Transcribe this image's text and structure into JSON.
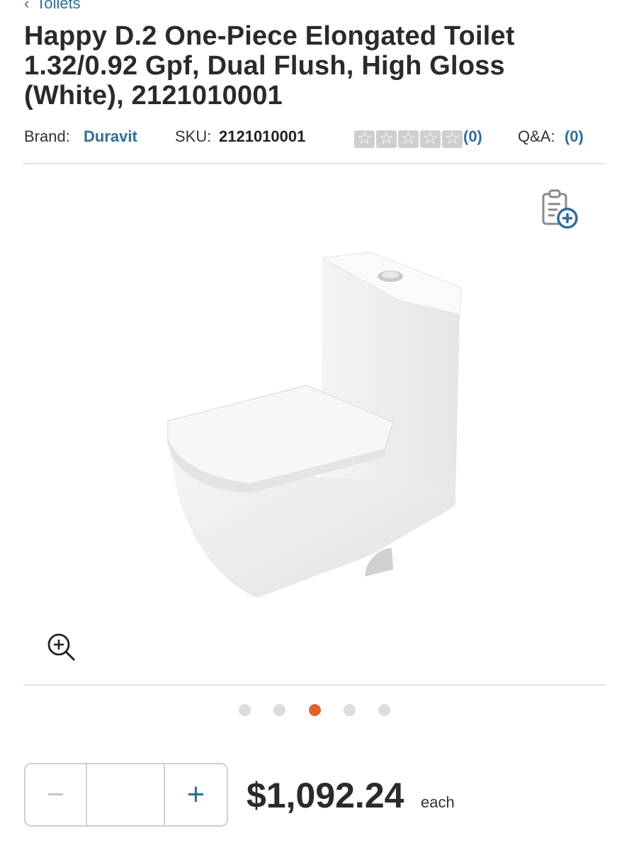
{
  "breadcrumb": {
    "label": "Toilets"
  },
  "product": {
    "title": "Happy D.2 One-Piece Elongated Toilet 1.32/0.92 Gpf, Dual Flush, High Gloss (White), 2121010001",
    "brand_label": "Brand:",
    "brand_value": "Duravit",
    "sku_label": "SKU:",
    "sku_value": "2121010001",
    "rating": {
      "stars_filled": 0,
      "stars_total": 5,
      "count_text": "(0)"
    },
    "qa_label": "Q&A:",
    "qa_count_text": "(0)"
  },
  "gallery": {
    "icons": {
      "compare": "clipboard-plus-icon",
      "zoom": "zoom-in-icon"
    },
    "slide_count": 5,
    "active_slide": 3
  },
  "purchase": {
    "quantity_value": "",
    "minus_label": "−",
    "plus_label": "+",
    "price": "$1,092.24",
    "price_unit": "each"
  },
  "colors": {
    "accent": "#2f6f9a",
    "active_dot": "#e1632b",
    "inactive_dot": "#dcdcdc"
  }
}
